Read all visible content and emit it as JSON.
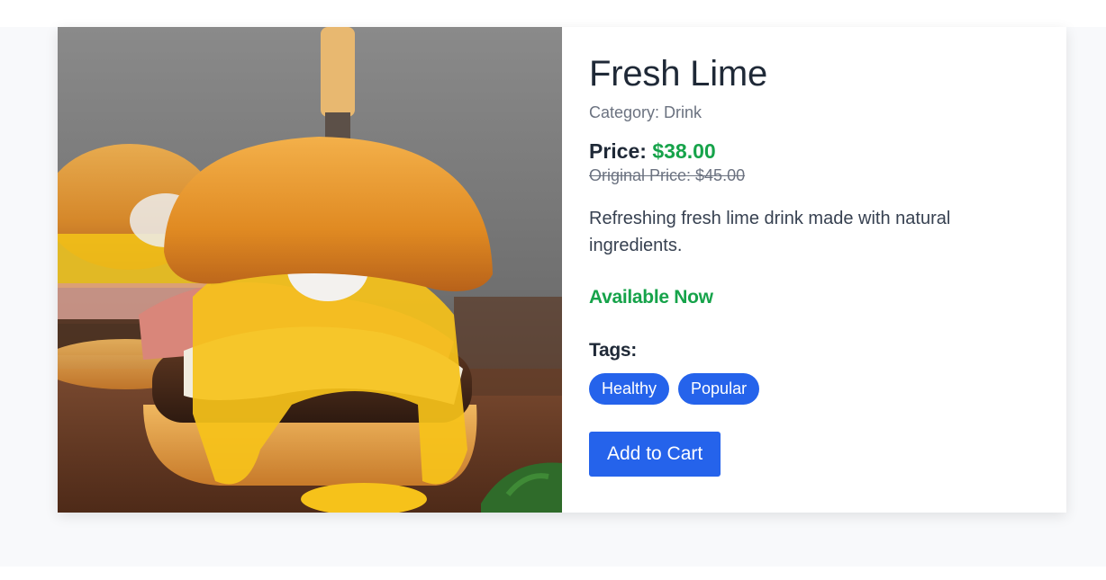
{
  "product": {
    "image_alt": "burger-photo",
    "title": "Fresh Lime",
    "category_label": "Category: ",
    "category_value": "Drink",
    "price_label": "Price: ",
    "price_value": "$38.00",
    "original_price": "Original Price: $45.00",
    "description": "Refreshing fresh lime drink made with natural ingredients.",
    "availability": "Available Now",
    "tags_heading": "Tags:",
    "tags": [
      "Healthy",
      "Popular"
    ],
    "add_to_cart_label": "Add to Cart"
  },
  "colors": {
    "accent": "#2563eb",
    "price_green": "#16a34a",
    "muted": "#6b7280",
    "text": "#1f2937"
  }
}
